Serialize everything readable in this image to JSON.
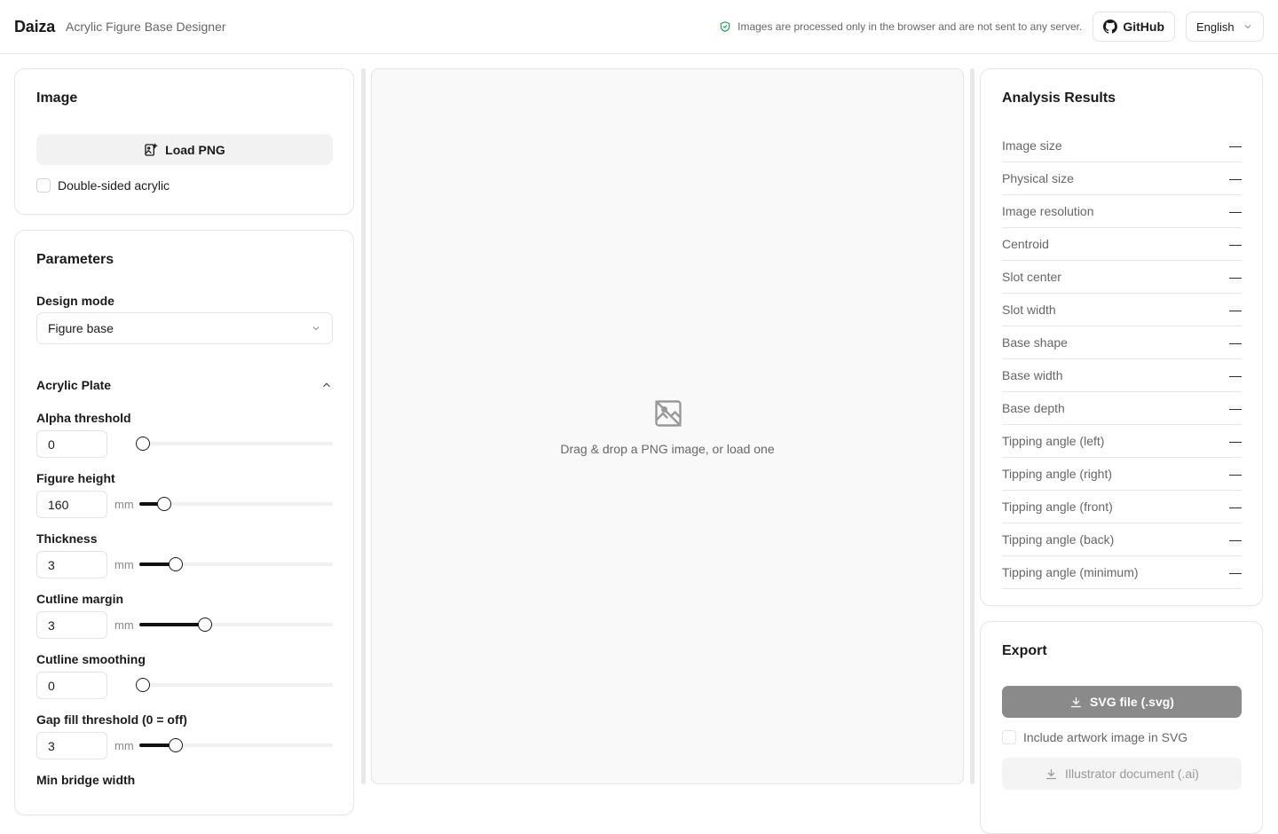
{
  "header": {
    "brand": "Daiza",
    "subtitle": "Acrylic Figure Base Designer",
    "privacy": "Images are processed only in the browser and are not sent to any server.",
    "github": "GitHub",
    "language": "English"
  },
  "image_panel": {
    "title": "Image",
    "load_button": "Load PNG",
    "double_sided": "Double-sided acrylic"
  },
  "params": {
    "title": "Parameters",
    "design_mode_label": "Design mode",
    "design_mode_value": "Figure base",
    "section": "Acrylic Plate",
    "alpha_label": "Alpha threshold",
    "alpha_value": "0",
    "height_label": "Figure height",
    "height_value": "160",
    "height_unit": "mm",
    "thickness_label": "Thickness",
    "thickness_value": "3",
    "thickness_unit": "mm",
    "margin_label": "Cutline margin",
    "margin_value": "3",
    "margin_unit": "mm",
    "smoothing_label": "Cutline smoothing",
    "smoothing_value": "0",
    "gap_label": "Gap fill threshold (0 = off)",
    "gap_value": "3",
    "gap_unit": "mm",
    "bridge_label": "Min bridge width"
  },
  "sliders": {
    "alpha": 0.0,
    "height": 0.11,
    "thickness": 0.17,
    "margin": 0.32,
    "smoothing": 0.0,
    "gap": 0.17
  },
  "preview": {
    "drop_text": "Drag & drop a PNG image, or load one"
  },
  "analysis": {
    "title": "Analysis Results",
    "rows": [
      {
        "label": "Image size",
        "value": "—"
      },
      {
        "label": "Physical size",
        "value": "—"
      },
      {
        "label": "Image resolution",
        "value": "—"
      },
      {
        "label": "Centroid",
        "value": "—"
      },
      {
        "label": "Slot center",
        "value": "—"
      },
      {
        "label": "Slot width",
        "value": "—"
      },
      {
        "label": "Base shape",
        "value": "—"
      },
      {
        "label": "Base width",
        "value": "—"
      },
      {
        "label": "Base depth",
        "value": "—"
      },
      {
        "label": "Tipping angle (left)",
        "value": "—"
      },
      {
        "label": "Tipping angle (right)",
        "value": "—"
      },
      {
        "label": "Tipping angle (front)",
        "value": "—"
      },
      {
        "label": "Tipping angle (back)",
        "value": "—"
      },
      {
        "label": "Tipping angle (minimum)",
        "value": "—"
      }
    ]
  },
  "export": {
    "title": "Export",
    "svg_button": "SVG file (.svg)",
    "include_artwork": "Include artwork image in SVG",
    "ai_button": "Illustrator document (.ai)"
  },
  "colors": {
    "accent": "#111111",
    "shield": "#16a34a",
    "disabled": "#8a8a8a"
  }
}
